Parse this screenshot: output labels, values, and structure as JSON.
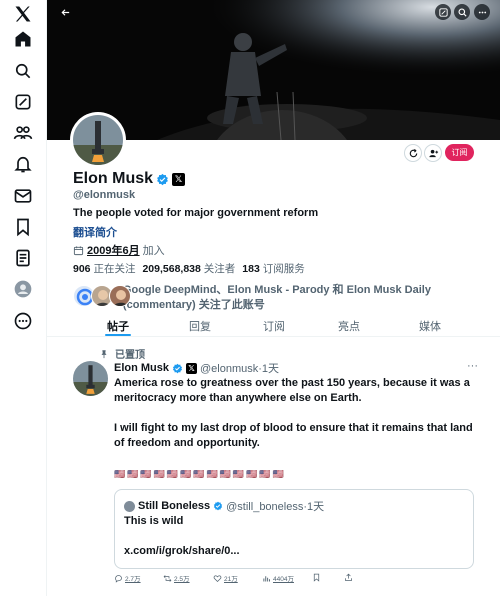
{
  "nav": {
    "items": [
      "x-logo",
      "home",
      "explore",
      "notifications-edit",
      "communities",
      "notifications",
      "messages",
      "bookmarks",
      "lists",
      "profile",
      "more"
    ]
  },
  "header": {
    "back_icon": "back-arrow-icon",
    "grok_icon": "grok-icon",
    "search_icon": "search-icon",
    "more_icon": "more-icon"
  },
  "profile": {
    "name": "Elon Musk",
    "handle": "@elonmusk",
    "bio": "The people voted for major government reform",
    "translate_label": "翻译简介",
    "joined_date": "2009年6月",
    "joined_suffix": "加入",
    "following_count": "906",
    "following_label": "正在关注",
    "followers_count": "209,568,838",
    "followers_label": "关注者",
    "subscriptions_count": "183",
    "subscriptions_label": "订阅服务",
    "subscribe_label": "订阅",
    "followed_by_text": "Google DeepMind、Elon Musk - Parody 和 Elon Musk Daily (commentary) 关注了此账号"
  },
  "tabs": [
    {
      "label": "帖子",
      "active": true
    },
    {
      "label": "回复",
      "active": false
    },
    {
      "label": "订阅",
      "active": false
    },
    {
      "label": "亮点",
      "active": false
    },
    {
      "label": "媒体",
      "active": false
    }
  ],
  "post": {
    "pinned_label": "已置顶",
    "author": "Elon Musk",
    "handle_time": "@elonmusk·1天",
    "paragraph1": "America rose to greatness over the past 150 years, because it was a meritocracy more than anywhere else on Earth.",
    "paragraph2": "I will fight to my last drop of blood to ensure that it remains that land of freedom and opportunity.",
    "flags": "🇺🇸🇺🇸🇺🇸🇺🇸🇺🇸🇺🇸🇺🇸🇺🇸🇺🇸🇺🇸🇺🇸🇺🇸🇺🇸",
    "more": "···",
    "quote": {
      "author": "Still Boneless",
      "handle_time": "@still_boneless·1天",
      "text": "This is wild",
      "link": "x.com/i/grok/share/0..."
    },
    "actions": {
      "replies": "2.7万",
      "reposts": "2.5万",
      "likes": "21万",
      "views": "4404万"
    }
  },
  "colors": {
    "accent": "#1d9bf0",
    "subscribe": "#e0245e",
    "text": "#0f1419",
    "muted": "#536471"
  }
}
